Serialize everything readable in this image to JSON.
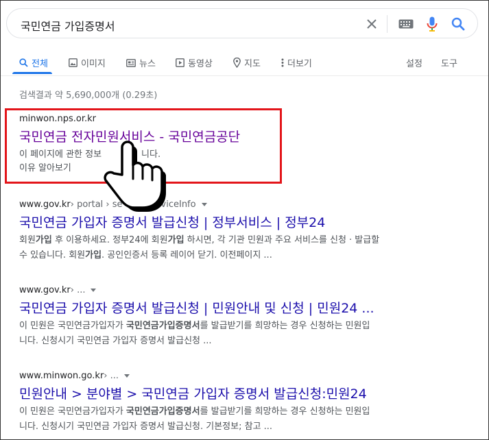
{
  "search": {
    "query": "국민연금 가입증명서"
  },
  "tabs": [
    {
      "label": "전체"
    },
    {
      "label": "이미지"
    },
    {
      "label": "뉴스"
    },
    {
      "label": "동영상"
    },
    {
      "label": "지도"
    },
    {
      "label": "더보기"
    },
    {
      "label": "설정"
    },
    {
      "label": "도구"
    }
  ],
  "stats": "검색결과 약 5,690,000개 (0.29초)",
  "results": [
    {
      "url": "minwon.nps.or.kr",
      "title": "국민연금 전자민원서비스 - 국민연금공단",
      "line1": "이 페이지에 관한 정보",
      "line1_tail": "니다.",
      "line2": "이유 알아보기"
    },
    {
      "url": "www.gov.kr",
      "path": " › portal › se",
      "path_tail": "viceInfo",
      "title": "국민연금 가입자 증명서 발급신청 | 정부서비스 | 정부24",
      "s1a": "회원",
      "s1b": "가입",
      "s1c": " 후 이용하세요. 정부24에 회원",
      "s1d": "가입",
      "s1e": " 하시면, 각 기관 민원과 주요 서비스를 신청 · 발급할",
      "s2a": "수 있습니다. 회원",
      "s2b": "가입",
      "s2c": ". 공인인증서 등록 레이어 닫기. 이전페이지 ..."
    },
    {
      "url": "www.gov.kr",
      "path": " › ...",
      "title": "국민연금 가입자 증명서 발급신청 | 민원안내 및 신청 | 민원24 ...",
      "s1a": "이 민원은 국민연금가입자가 ",
      "s1b": "국민연금가입증명서",
      "s1c": "를 발급받기를 희망하는 경우 신청하는 민원입",
      "s2": "니다. 신청시기 국민연금 가입자 증명서 발급신청 ..."
    },
    {
      "url": "www.minwon.go.kr",
      "path": " › ...",
      "title": "민원안내 > 분야별 > 국민연금 가입자 증명서 발급신청:민원24",
      "s1a": "이 민원은 국민연금가입자가 ",
      "s1b": "국민연금가입증명서",
      "s1c": "를 발급받기를 희망하는 경우 신청하는 민원입",
      "s2": "니다. 신청시기 국민연금 가입자 증명서 발급신청. 기본정보; 참고 ..."
    }
  ]
}
